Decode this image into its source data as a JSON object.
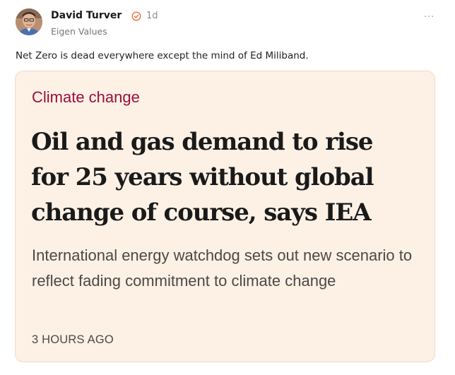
{
  "author": {
    "name": "David Turver",
    "post_age": "1d",
    "publication": "Eigen Values",
    "avatar_icon": "author-photo",
    "verified_icon": "verified-badge-icon"
  },
  "post": {
    "text": "Net Zero is dead everywhere except the mind of Ed Miliband.",
    "more_icon": "more-options-icon",
    "more_glyph": "···"
  },
  "link_card": {
    "section": "Climate change",
    "headline": "Oil and gas demand to rise for 25 years without global change of course, says IEA",
    "standfirst": "International energy watchdog sets out new scenario to reflect fading commitment to climate change",
    "timestamp": "3 HOURS AGO"
  },
  "colors": {
    "card_background": "#fdf1e6",
    "section_accent": "#990f3d",
    "verified_badge": "#e8743b"
  }
}
